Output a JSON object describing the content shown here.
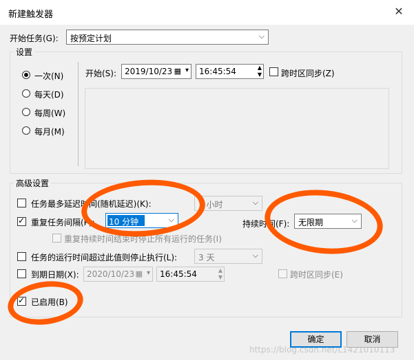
{
  "window": {
    "title": "新建触发器",
    "close_glyph": "✕"
  },
  "begin_task": {
    "label": "开始任务(G):",
    "value": "按预定计划"
  },
  "settings": {
    "group_label": "设置",
    "radios": [
      {
        "label": "一次(N)",
        "checked": true
      },
      {
        "label": "每天(D)",
        "checked": false
      },
      {
        "label": "每周(W)",
        "checked": false
      },
      {
        "label": "每月(M)",
        "checked": false
      }
    ],
    "start_label": "开始(S):",
    "start_date": "2019/10/23",
    "start_time": "16:45:54",
    "sync_label": "跨时区同步(Z)"
  },
  "advanced": {
    "group_label": "高级设置",
    "delay": {
      "label": "任务最多延迟时间(随机延迟)(K):",
      "value": "1 小时",
      "checked": false
    },
    "repeat": {
      "label": "重复任务间隔(P):",
      "value": "10 分钟",
      "checked": true
    },
    "duration": {
      "label": "持续时间(F):",
      "value": "无限期"
    },
    "stop_all": {
      "label": "重复持续时间结束时停止所有运行的任务(I)",
      "checked": false
    },
    "stop_longer": {
      "label": "任务的运行时间超过此值则停止执行(L):",
      "value": "3 天",
      "checked": false
    },
    "expire": {
      "label": "到期日期(X):",
      "date": "2020/10/23",
      "time": "16:45:54",
      "checked": false,
      "sync_label": "跨时区同步(E)"
    },
    "enabled": {
      "label": "已启用(B)",
      "checked": true
    }
  },
  "buttons": {
    "ok": "确定",
    "cancel": "取消"
  },
  "watermark": "https://blog.csdn.net/L1421010113",
  "colors": {
    "highlight_ring": "#ff5a00",
    "selection": "#0078d7"
  }
}
